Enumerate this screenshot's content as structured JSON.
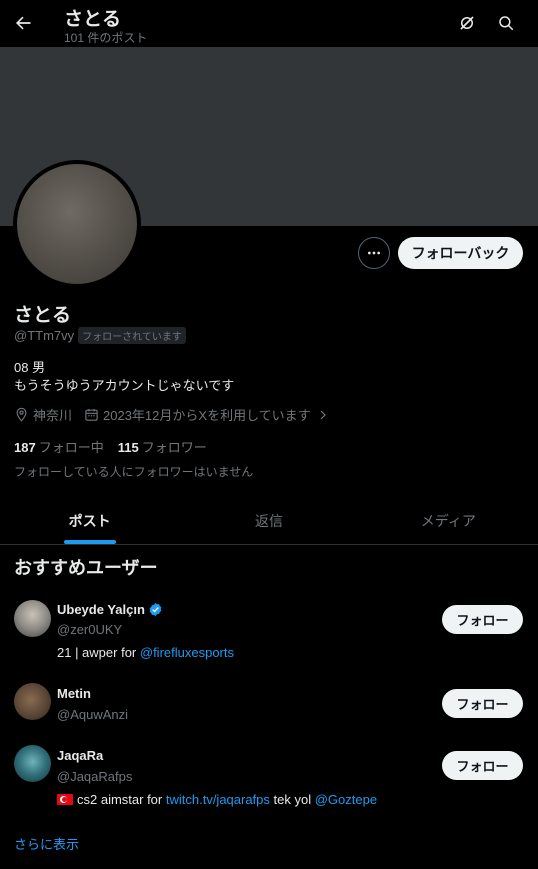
{
  "header": {
    "title": "さとる",
    "subtitle": "101 件のポスト"
  },
  "profile": {
    "name": "さとる",
    "handle": "@TTm7vy",
    "follows_you": "フォローされています",
    "bio_line1": "08 男",
    "bio_line2": "もうそうゆうアカウントじゃないです",
    "location": "神奈川",
    "joined": "2023年12月からXを利用しています",
    "following_count": "187",
    "following_label": "フォロー中",
    "followers_count": "115",
    "followers_label": "フォロワー",
    "no_common_followers": "フォローしている人にフォロワーはいません",
    "follow_back_label": "フォローバック"
  },
  "tabs": [
    {
      "label": "ポスト",
      "active": true
    },
    {
      "label": "返信",
      "active": false
    },
    {
      "label": "メディア",
      "active": false
    }
  ],
  "recommended": {
    "title": "おすすめユーザー",
    "users": [
      {
        "name": "Ubeyde Yalçın",
        "handle": "@zer0UKY",
        "verified": true,
        "bio_text": "21 | awper for ",
        "bio_link": "@firefluxesports",
        "follow_label": "フォロー"
      },
      {
        "name": "Metin",
        "handle": "@AquwAnzi",
        "verified": false,
        "follow_label": "フォロー"
      },
      {
        "name": "JaqaRa",
        "handle": "@JaqaRafps",
        "verified": false,
        "bio_text": "cs2 aimstar for ",
        "bio_link": "twitch.tv/jaqarafps",
        "bio_text2": " tek yol ",
        "bio_link2": "@Goztepe",
        "follow_label": "フォロー"
      }
    ],
    "show_more": "さらに表示"
  },
  "colors": {
    "accent": "#1d9bf0",
    "background": "#000000",
    "banner": "#333639",
    "text_secondary": "#71767b"
  }
}
